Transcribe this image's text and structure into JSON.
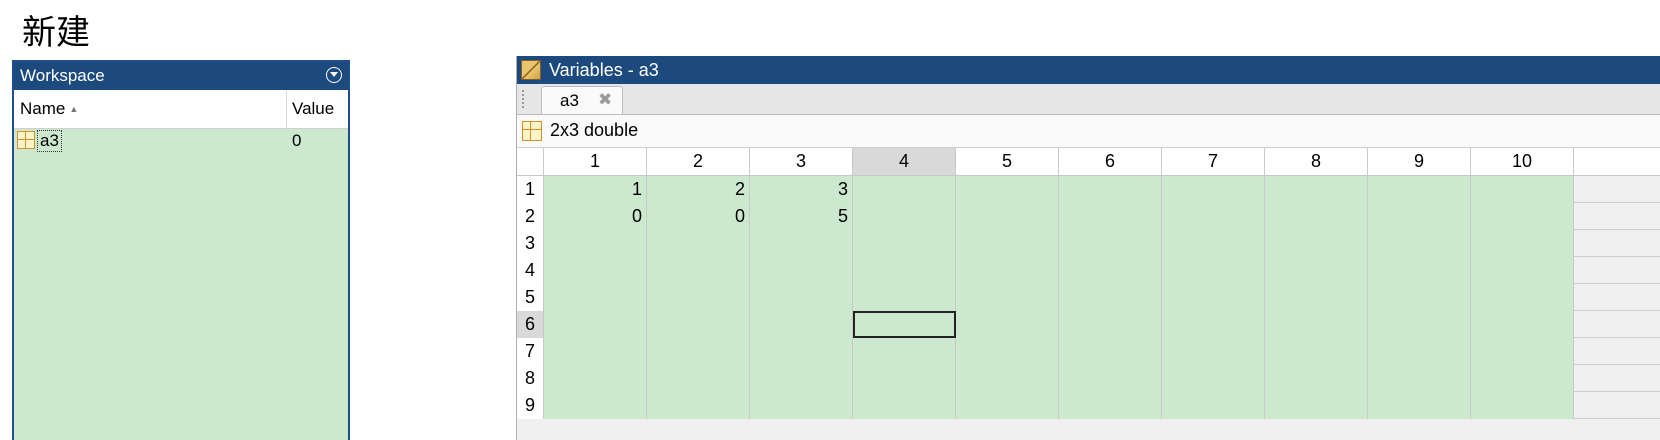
{
  "heading": "新建",
  "workspace": {
    "title": "Workspace",
    "col_name": "Name",
    "col_value": "Value",
    "variables": [
      {
        "name": "a3",
        "value": "0"
      }
    ]
  },
  "variables_editor": {
    "title": "Variables - a3",
    "tab_label": "a3",
    "tab_close": "✖",
    "info": "2x3 double",
    "columns": [
      "1",
      "2",
      "3",
      "4",
      "5",
      "6",
      "7",
      "8",
      "9",
      "10"
    ],
    "rows": [
      {
        "label": "1",
        "cells": [
          "1",
          "2",
          "3",
          "",
          "",
          "",
          "",
          "",
          "",
          ""
        ]
      },
      {
        "label": "2",
        "cells": [
          "0",
          "0",
          "5",
          "",
          "",
          "",
          "",
          "",
          "",
          ""
        ]
      },
      {
        "label": "3",
        "cells": [
          "",
          "",
          "",
          "",
          "",
          "",
          "",
          "",
          "",
          ""
        ]
      },
      {
        "label": "4",
        "cells": [
          "",
          "",
          "",
          "",
          "",
          "",
          "",
          "",
          "",
          ""
        ]
      },
      {
        "label": "5",
        "cells": [
          "",
          "",
          "",
          "",
          "",
          "",
          "",
          "",
          "",
          ""
        ]
      },
      {
        "label": "6",
        "cells": [
          "",
          "",
          "",
          "",
          "",
          "",
          "",
          "",
          "",
          ""
        ]
      },
      {
        "label": "7",
        "cells": [
          "",
          "",
          "",
          "",
          "",
          "",
          "",
          "",
          "",
          ""
        ]
      },
      {
        "label": "8",
        "cells": [
          "",
          "",
          "",
          "",
          "",
          "",
          "",
          "",
          "",
          ""
        ]
      },
      {
        "label": "9",
        "cells": [
          "",
          "",
          "",
          "",
          "",
          "",
          "",
          "",
          "",
          ""
        ]
      }
    ],
    "selected_row": "6",
    "selected_col": "4",
    "cell_fill_color": "#cce8cf",
    "title_bar_color": "#1c4a7e"
  }
}
